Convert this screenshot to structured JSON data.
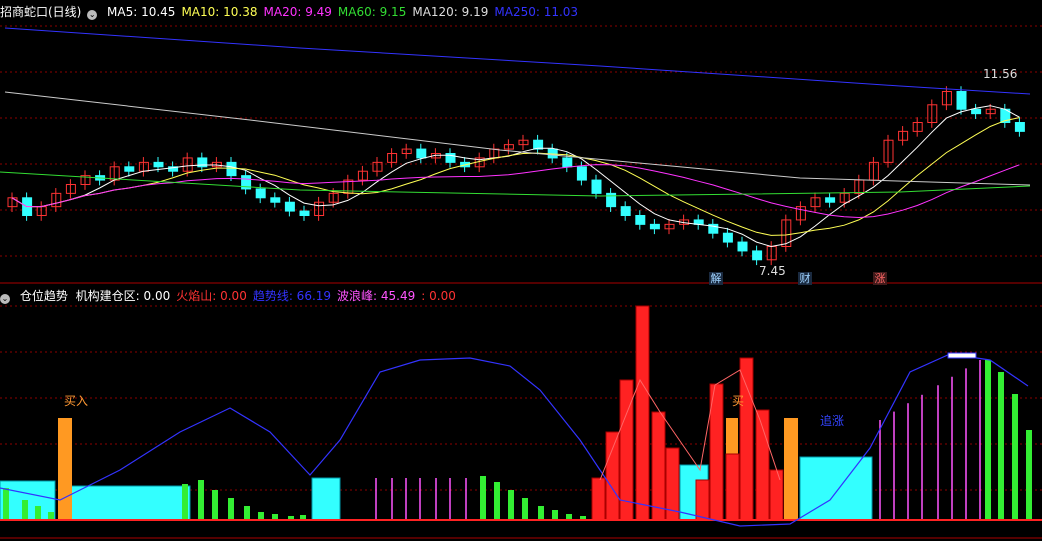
{
  "main_panel": {
    "title": "招商蛇口(日线)",
    "ma": [
      {
        "label": "MA5: 10.45",
        "color": "#ffffff"
      },
      {
        "label": "MA10: 10.38",
        "color": "#ffff55"
      },
      {
        "label": "MA20: 9.49",
        "color": "#ff33ff"
      },
      {
        "label": "MA60: 9.15",
        "color": "#33dd33"
      },
      {
        "label": "MA120: 9.19",
        "color": "#dddddd"
      },
      {
        "label": "MA250: 11.03",
        "color": "#3333ff"
      }
    ],
    "high_label": "11.56",
    "low_label": "7.45",
    "markers": [
      {
        "text": "解",
        "color": "#9fd3ff"
      },
      {
        "text": "财",
        "color": "#9fd3ff"
      },
      {
        "text": "涨",
        "color": "#ff6666"
      }
    ]
  },
  "sub_panel": {
    "title": "仓位趋势",
    "items": [
      {
        "label": "机构建仓区: 0.00",
        "color": "#ffffff"
      },
      {
        "label": "火焰山: 0.00",
        "color": "#ff3333"
      },
      {
        "label": "趋势线: 66.19",
        "color": "#3333ff"
      },
      {
        "label": "波浪峰: 45.49",
        "color": "#ff55ff"
      },
      {
        "label": ": 0.00",
        "color": "#ff3333"
      }
    ],
    "annotations": [
      {
        "text": "买入",
        "color": "#ff9933"
      },
      {
        "text": "买",
        "color": "#ff9933"
      },
      {
        "text": "追涨",
        "color": "#3344ff"
      }
    ]
  },
  "colors": {
    "up": "#ff3333",
    "down": "#33ffff",
    "bg": "#000000",
    "grid": "#8b0000"
  }
}
